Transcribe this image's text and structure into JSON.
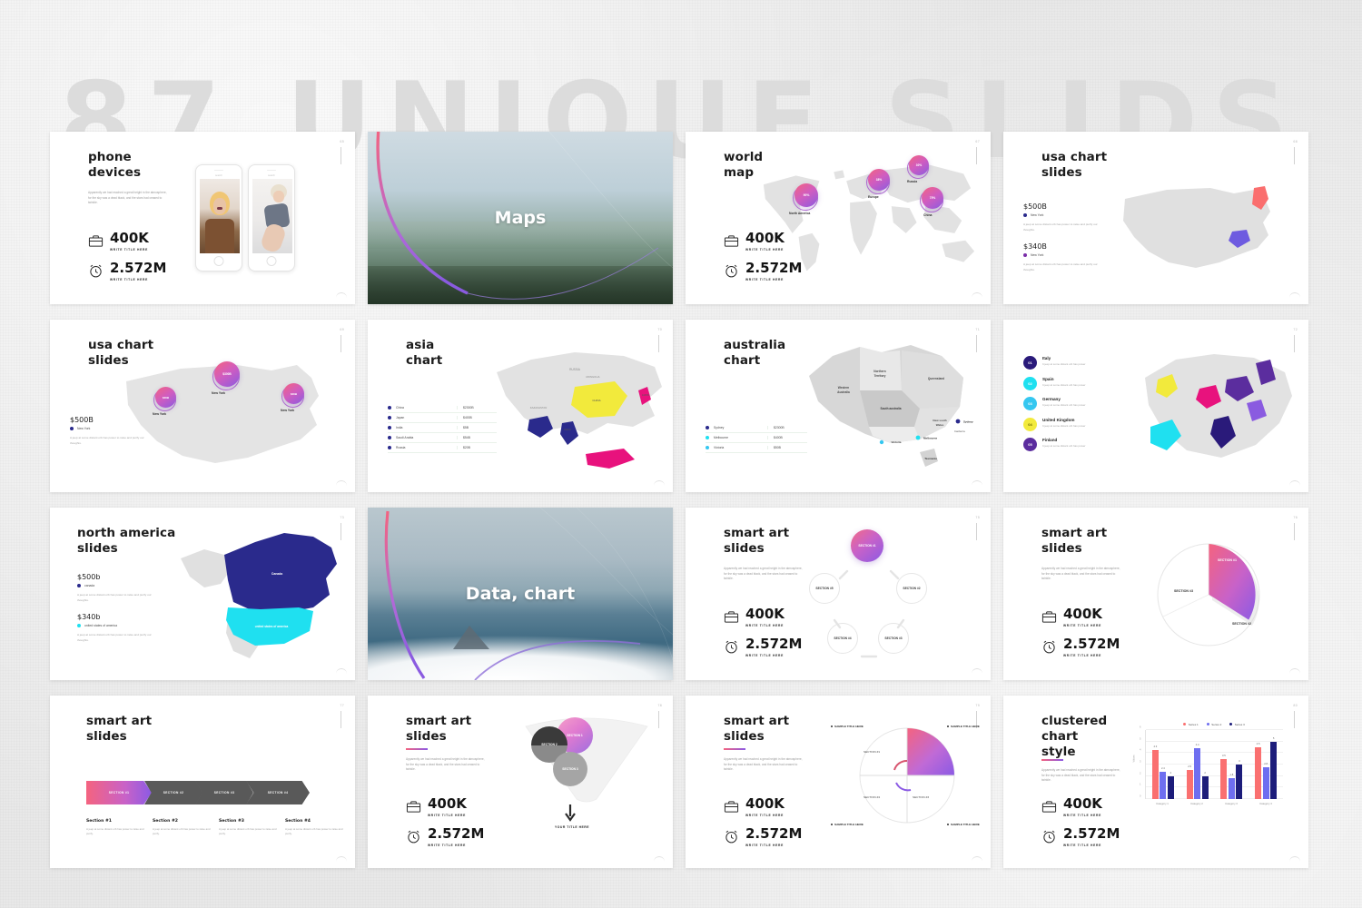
{
  "watermark": "87 UNIQUE SLIDS",
  "common": {
    "lorem": "Apparently we had reached a great height in the atmosphere, for the sky was a dead black, and the stars had ceased to twinkle.",
    "lorem_short": "A jeep at some distant orb has power to raise and purify our thoughts.",
    "stat1_value": "400K",
    "stat1_label": "WRITE TITLE HERE",
    "stat2_value": "2.572M",
    "stat2_label": "WRITE TITLE HERE",
    "briefcase_icon": "briefcase-icon",
    "clock_icon": "alarm-clock-icon"
  },
  "colors": {
    "grad_start": "#f4637f",
    "grad_mid": "#d05cc0",
    "grad_end": "#8a5be0",
    "navy": "#2a2a8c",
    "cyan": "#1fe0f0",
    "yellow": "#f2ea3c",
    "magenta": "#e8127d",
    "purple": "#5b2d9e",
    "coral": "#fa6e6e",
    "map_gray": "#e0e0e0",
    "series1": "#fa7070",
    "series2": "#6e6ef0",
    "series3": "#1c1c7a"
  },
  "slides": [
    {
      "num": "65",
      "title": "phone\ndevices",
      "title_line1": "phone",
      "title_line2": "devices",
      "phone_search": "search",
      "type": "phone-devices"
    },
    {
      "num": "66",
      "title": "Maps",
      "type": "section-maps"
    },
    {
      "num": "67",
      "title_line1": "world",
      "title_line2": "map",
      "type": "world-map",
      "bubbles": [
        {
          "value": "90%",
          "label": "North America"
        },
        {
          "value": "38%",
          "label": "Europe"
        },
        {
          "value": "30%",
          "label": "Russia"
        },
        {
          "value": "75%",
          "label": "China"
        }
      ]
    },
    {
      "num": "68",
      "title_line1": "usa chart",
      "title_line2": "slides",
      "type": "usa-regions",
      "items": [
        {
          "amount": "$500B",
          "label": "New York",
          "color": "#2a2a8c"
        },
        {
          "amount": "$340B",
          "label": "New York",
          "color": "#7a2da8"
        }
      ]
    },
    {
      "num": "69",
      "title_line1": "usa chart",
      "title_line2": "slides",
      "type": "usa-bubbles",
      "amount": "$500B",
      "legend_label": "New York",
      "bubbles": [
        {
          "value": "$30B",
          "label": "New York"
        },
        {
          "value": "$300B",
          "label": "New York"
        },
        {
          "value": "$30B",
          "label": "New York"
        }
      ]
    },
    {
      "num": "70",
      "title_line1": "asia",
      "title_line2": "chart",
      "type": "asia-chart",
      "table": [
        {
          "name": "China",
          "value": "$2300B",
          "color": "#2a2a8c"
        },
        {
          "name": "Japan",
          "value": "$400B",
          "color": "#2a2a8c"
        },
        {
          "name": "India",
          "value": "$5B",
          "color": "#2a2a8c"
        },
        {
          "name": "Saudi Arabia",
          "value": "$54B",
          "color": "#2a2a8c"
        },
        {
          "name": "Russia",
          "value": "$20B",
          "color": "#2a2a8c"
        }
      ]
    },
    {
      "num": "71",
      "title_line1": "australia",
      "title_line2": "chart",
      "type": "australia-chart",
      "table": [
        {
          "name": "Sydney",
          "value": "$2300B",
          "color": "#2a2a8c"
        },
        {
          "name": "Melbourne",
          "value": "$400B",
          "color": "#1fe0f0"
        },
        {
          "name": "Victoria",
          "value": "$50B",
          "color": "#35c7f0"
        }
      ],
      "regions": [
        "Northern Territory",
        "Western Australia",
        "Queensland",
        "South australia",
        "New south Wales",
        "Victoria",
        "Tasmania"
      ],
      "cities": [
        "Sydney",
        "Canberra",
        "Melbourne",
        "Victoria"
      ]
    },
    {
      "num": "72",
      "type": "europe-chart",
      "items": [
        {
          "num": "01",
          "name": "Italy",
          "color": "#2a1a7a",
          "desc": "It jeep at some distant orb has power"
        },
        {
          "num": "02",
          "name": "Spain",
          "color": "#1fe0f0",
          "desc": "It jeep at some distant orb has power"
        },
        {
          "num": "03",
          "name": "Germany",
          "color": "#35c7f0",
          "desc": "It jeep at some distant orb has power"
        },
        {
          "num": "04",
          "name": "United Kingdom",
          "color": "#f2ea3c",
          "desc": "It jeep at some distant orb has power"
        },
        {
          "num": "05",
          "name": "Finland",
          "color": "#5b2d9e",
          "desc": "It jeep at some distant orb has power"
        }
      ]
    },
    {
      "num": "73",
      "title_line1": "north america",
      "title_line2": "slides",
      "type": "north-america",
      "items": [
        {
          "amount": "$500b",
          "label": "canada",
          "color": "#2a2a8c"
        },
        {
          "amount": "$340b",
          "label": "united states of america",
          "color": "#1fe0f0"
        }
      ]
    },
    {
      "num": "74",
      "title": "Data, chart",
      "type": "section-data"
    },
    {
      "num": "75",
      "title_line1": "smart art",
      "title_line2": "slides",
      "type": "smartart-cycle",
      "nodes": [
        "SECTION #1",
        "SECTION #2",
        "SECTION #3",
        "SECTION #4",
        "SECTION #5"
      ]
    },
    {
      "num": "76",
      "title_line1": "smart art",
      "title_line2": "slides",
      "type": "smartart-pie",
      "sections": [
        "SECTION #1",
        "SECTION #2",
        "SECTION #3"
      ]
    },
    {
      "num": "77",
      "title_line1": "smart art",
      "title_line2": "slides",
      "type": "smartart-chevron",
      "chevrons": [
        "SECTION #1",
        "SECTION #2",
        "SECTION #3",
        "SECTION #4"
      ],
      "blocks": [
        {
          "head": "Section #1",
          "body": "A jeep at some distant orb has power to raise and purify."
        },
        {
          "head": "Section #2",
          "body": "A jeep at some distant orb has power to raise and purify."
        },
        {
          "head": "Section #3",
          "body": "A jeep at some distant orb has power to raise and purify."
        },
        {
          "head": "Section #4",
          "body": "A jeep at some distant orb has power to raise and purify."
        }
      ]
    },
    {
      "num": "78",
      "title_line1": "smart art",
      "title_line2": "slides",
      "type": "smartart-funnel",
      "circles": [
        "SECTION 1",
        "SECTION 2",
        "SECTION 3"
      ],
      "footer": "YOUR TITLE HERE"
    },
    {
      "num": "79",
      "title_line1": "smart art",
      "title_line2": "slides",
      "type": "smartart-quadrant",
      "sections": [
        "SECTION #1",
        "SECTION #2",
        "SECTION #3",
        "SECTION #4"
      ],
      "callouts": [
        "SAMPLE TITLE HERE",
        "SAMPLE TITLE HERE",
        "SAMPLE TITLE HERE",
        "SAMPLE TITLE HERE"
      ]
    },
    {
      "num": "80",
      "title_line1": "clustered",
      "title_line2": "chart",
      "title_line3": "style",
      "type": "clustered-chart"
    }
  ],
  "chart_data": {
    "type": "bar",
    "title": "",
    "categories": [
      "Category 1",
      "Category 2",
      "Category 3",
      "Category 4"
    ],
    "series": [
      {
        "name": "Series 1",
        "values": [
          4.3,
          2.5,
          3.5,
          4.5
        ],
        "color": "#fa7070"
      },
      {
        "name": "Series 2",
        "values": [
          2.4,
          4.4,
          1.8,
          2.8
        ],
        "color": "#6e6ef0"
      },
      {
        "name": "Series 3",
        "values": [
          2,
          2,
          3,
          5
        ],
        "color": "#1c1c7a"
      }
    ],
    "yticks": [
      0,
      1,
      2,
      3,
      4,
      5,
      6
    ],
    "ylim": [
      0,
      6
    ],
    "xlabel": "",
    "ylabel": "Values",
    "grid": true,
    "legend": "top"
  }
}
